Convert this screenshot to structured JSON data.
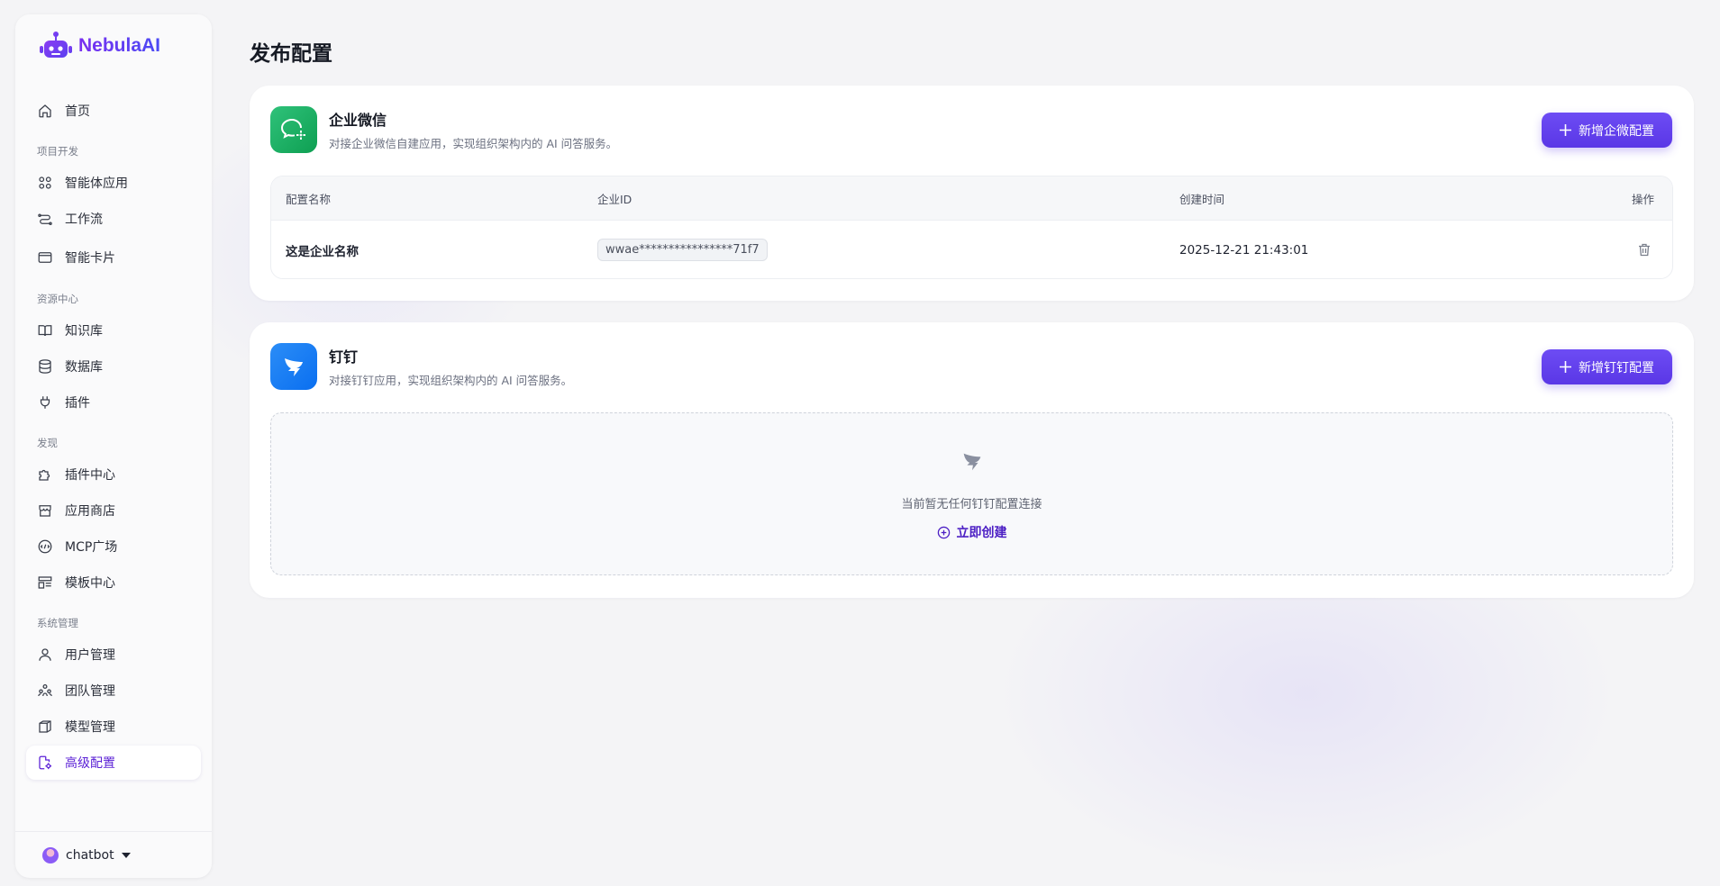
{
  "brand": {
    "name": "NebulaAI"
  },
  "nav": {
    "home": "首页",
    "section_dev": "项目开发",
    "agents": "智能体应用",
    "workflow": "工作流",
    "cards": "智能卡片",
    "section_resources": "资源中心",
    "knowledge": "知识库",
    "database": "数据库",
    "plugins": "插件",
    "section_discover": "发现",
    "plugin_center": "插件中心",
    "app_store": "应用商店",
    "mcp": "MCP广场",
    "templates": "模板中心",
    "section_system": "系统管理",
    "users": "用户管理",
    "teams": "团队管理",
    "models": "模型管理",
    "advanced": "高级配置"
  },
  "user": {
    "name": "chatbot"
  },
  "page": {
    "title": "发布配置"
  },
  "wecom": {
    "title": "企业微信",
    "description": "对接企业微信自建应用，实现组织架构内的 AI 问答服务。",
    "add_button": "新增企微配置",
    "columns": {
      "name": "配置名称",
      "corp_id": "企业ID",
      "created": "创建时间",
      "actions": "操作"
    },
    "rows": [
      {
        "name": "这是企业名称",
        "corp_id": "wwae****************71f7",
        "created": "2025-12-21 21:43:01"
      }
    ]
  },
  "dingtalk": {
    "title": "钉钉",
    "description": "对接钉钉应用，实现组织架构内的 AI 问答服务。",
    "add_button": "新增钉钉配置",
    "empty_text": "当前暂无任何钉钉配置连接",
    "create_now": "立即创建"
  },
  "colors": {
    "accent": "#5b21d6",
    "button": "#6241ee",
    "wecom": "#16a85d",
    "dingtalk": "#1683f5"
  }
}
